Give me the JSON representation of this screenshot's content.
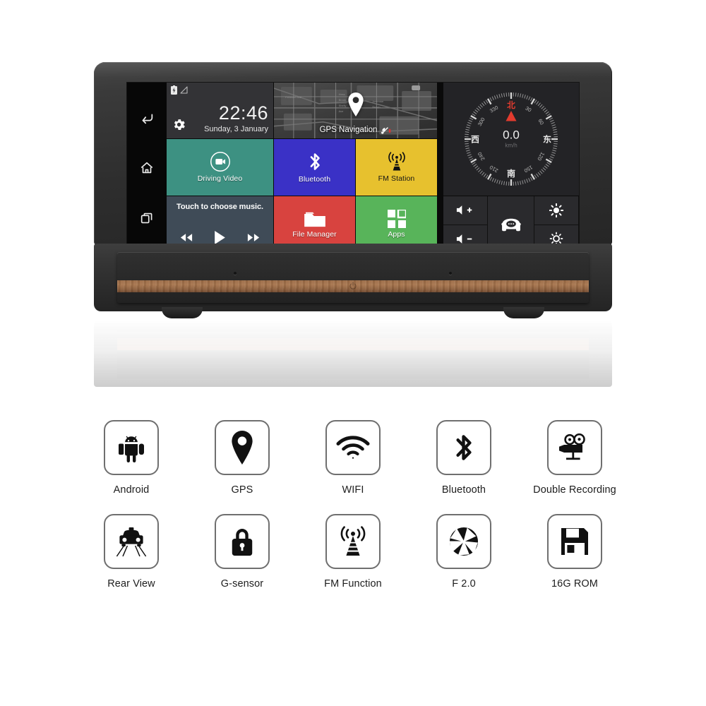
{
  "device": {
    "name": "car-dashboard-dvr-navigator",
    "nav_rail": [
      {
        "name": "back-icon",
        "label": "Back"
      },
      {
        "name": "home-icon",
        "label": "Home"
      },
      {
        "name": "recent-apps-icon",
        "label": "Recent Apps"
      }
    ],
    "status_bar": {
      "battery_icon": "battery-charging-icon",
      "signal_icon": "signal-triangle-icon"
    },
    "clock": {
      "time": "22:46",
      "date": "Sunday, 3 January",
      "settings_icon": "gear-icon"
    },
    "map_tile": {
      "caption": "GPS Navigation",
      "pin_icon": "map-pin-icon",
      "satellite_icon": "satellite-dish-icon"
    },
    "tiles": [
      {
        "name": "driving-video",
        "label": "Driving Video",
        "icon": "video-camera-circle-icon",
        "color": "#3d9182"
      },
      {
        "name": "bluetooth",
        "label": "Bluetooth",
        "icon": "bluetooth-icon",
        "color": "#3a31c6"
      },
      {
        "name": "fm-station",
        "label": "FM Station",
        "icon": "radio-tower-icon",
        "color": "#e7c12e"
      },
      {
        "name": "file-manager",
        "label": "File Manager",
        "icon": "folder-icon",
        "color": "#d8433f"
      },
      {
        "name": "apps",
        "label": "Apps",
        "icon": "grid-squares-icon",
        "color": "#58b45a"
      }
    ],
    "music": {
      "title": "Touch to choose music.",
      "prev_icon": "rewind-icon",
      "play_icon": "play-icon",
      "next_icon": "fast-forward-icon",
      "color": "#3f4b57"
    },
    "compass": {
      "north": "北",
      "south": "南",
      "west": "西",
      "east": "东",
      "north_color": "#e23b2e",
      "degree_ticks": [
        "30",
        "60",
        "120",
        "150",
        "210",
        "240",
        "300",
        "330"
      ],
      "speed_value": "0.0",
      "speed_unit": "km/h",
      "heading_arrow_icon": "compass-arrow-icon"
    },
    "hw_keys": [
      {
        "name": "volume-up-button",
        "icon": "speaker-plus-icon"
      },
      {
        "name": "volume-down-button",
        "icon": "speaker-minus-icon"
      },
      {
        "name": "car-mode-button",
        "icon": "car-icon"
      },
      {
        "name": "brightness-up-button",
        "icon": "brightness-high-icon"
      },
      {
        "name": "brightness-down-button",
        "icon": "brightness-low-icon"
      }
    ],
    "base": {
      "power_icon": "power-icon",
      "wood_color": "#9a6a45"
    }
  },
  "features": {
    "row1": [
      {
        "label": "Android",
        "icon": "android-icon"
      },
      {
        "label": "GPS",
        "icon": "map-pin-icon"
      },
      {
        "label": "WIFI",
        "icon": "wifi-icon"
      },
      {
        "label": "Bluetooth",
        "icon": "bluetooth-icon"
      },
      {
        "label": "Double Recording",
        "icon": "movie-camera-icon"
      }
    ],
    "row2": [
      {
        "label": "Rear View",
        "icon": "rear-view-car-icon"
      },
      {
        "label": "G-sensor",
        "icon": "lock-icon"
      },
      {
        "label": "FM Function",
        "icon": "radio-tower-icon"
      },
      {
        "label": "F 2.0",
        "icon": "aperture-icon"
      },
      {
        "label": "16G ROM",
        "icon": "floppy-disk-icon"
      }
    ]
  }
}
